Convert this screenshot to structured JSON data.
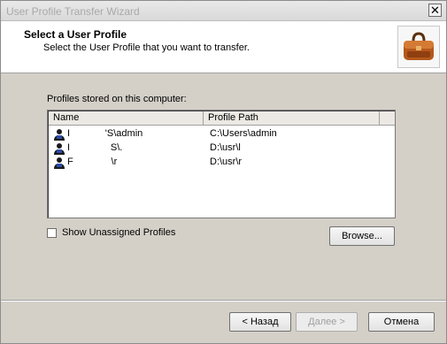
{
  "window": {
    "title": "User Profile Transfer Wizard"
  },
  "header": {
    "title": "Select a User Profile",
    "subtitle": "Select the User Profile that you want to transfer."
  },
  "profiles": {
    "label": "Profiles stored on this computer:",
    "columns": {
      "name": "Name",
      "path": "Profile Path"
    },
    "rows": [
      {
        "name_prefix": "I",
        "name_hidden": "             ",
        "name_suffix": "'S\\admin",
        "path": "C:\\Users\\admin",
        "path_hidden": ""
      },
      {
        "name_prefix": "I",
        "name_hidden": "               ",
        "name_suffix": "S\\.",
        "path": "D:\\usr\\l",
        "path_hidden": ""
      },
      {
        "name_prefix": "F",
        "name_hidden": "              ",
        "name_suffix": "\\r",
        "path": "D:\\usr\\r",
        "path_hidden": "      "
      }
    ]
  },
  "options": {
    "show_unassigned": "Show Unassigned Profiles",
    "show_unassigned_checked": false
  },
  "buttons": {
    "browse": "Browse...",
    "back": "< Назад",
    "next": "Далее >",
    "cancel": "Отмена"
  },
  "colors": {
    "header_bg": "#ffffff",
    "dialog_bg": "#d4d0c8",
    "title_text": "#a9a9a9"
  }
}
